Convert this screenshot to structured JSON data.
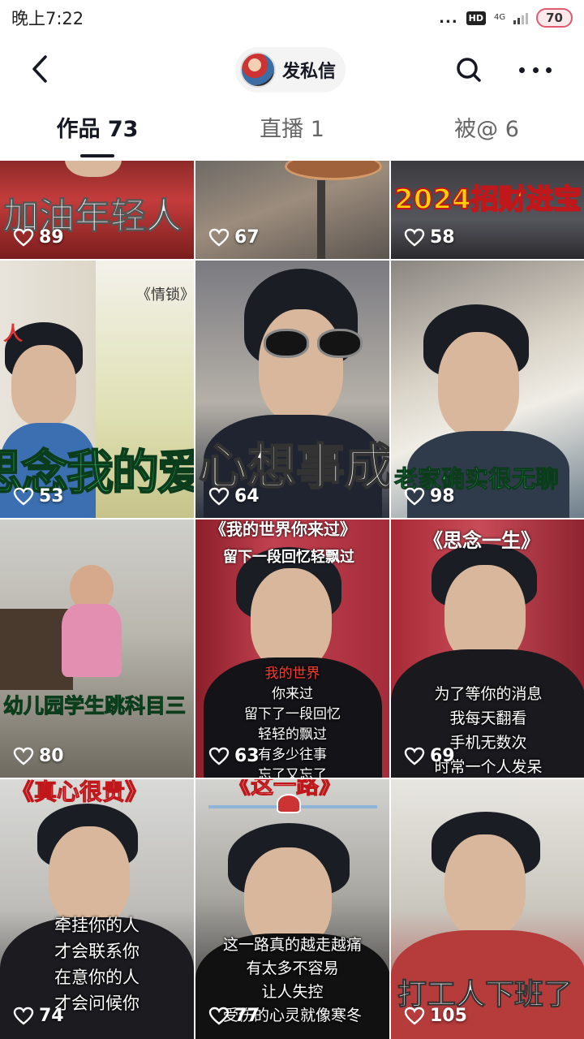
{
  "status_bar": {
    "time": "晚上7:22",
    "dots": "...",
    "hd": "HD",
    "network": "4G",
    "battery": "70"
  },
  "header": {
    "back_icon": "chevron-left-icon",
    "dm_label": "发私信",
    "search_icon": "search-icon",
    "more_icon": "more-dots-icon"
  },
  "tabs": [
    {
      "label": "作品 73",
      "active": true
    },
    {
      "label": "直播 1",
      "active": false
    },
    {
      "label": "被@ 6",
      "active": false
    }
  ],
  "videos": [
    {
      "overlay": "加油年轻人",
      "likes": "89"
    },
    {
      "overlay": "",
      "likes": "67"
    },
    {
      "overlay": "2024招财进宝",
      "likes": "58"
    },
    {
      "overlay": "思念我的爱",
      "side_title": "《情锁》",
      "side_mark": "人",
      "likes": "53"
    },
    {
      "overlay": "心想事成",
      "likes": "64"
    },
    {
      "overlay": "老家确实很无聊",
      "likes": "98"
    },
    {
      "overlay": "幼儿园学生跳科目三",
      "likes": "80"
    },
    {
      "top_title": "《我的世界你来过》",
      "subtitle": "留下一段回忆轻飘过",
      "lines": [
        "我的世界",
        "你来过",
        "留下了一段回忆",
        "轻轻的飘过",
        "有多少往事",
        "忘了又忘了"
      ],
      "likes": "63"
    },
    {
      "top_title": "《思念一生》",
      "lines": [
        "为了等你的消息",
        "我每天翻看",
        "手机无数次",
        "时常一个人发呆"
      ],
      "likes": "69"
    },
    {
      "top_title": "《真心很贵》",
      "lines": [
        "牵挂你的人",
        "才会联系你",
        "在意你的人",
        "才会问候你"
      ],
      "likes": "74"
    },
    {
      "top_title": "《这一路》",
      "lines": [
        "这一路真的越走越痛",
        "有太多不容易",
        "让人失控",
        "受伤的心灵就像寒冬"
      ],
      "likes": "77"
    },
    {
      "overlay": "打工人下班了",
      "likes": "105"
    }
  ],
  "colors": {
    "accent_text": "#161823",
    "battery_border": "#e05a6f",
    "green_caption": "#2ecc71",
    "red_caption": "#ff3b2f"
  }
}
